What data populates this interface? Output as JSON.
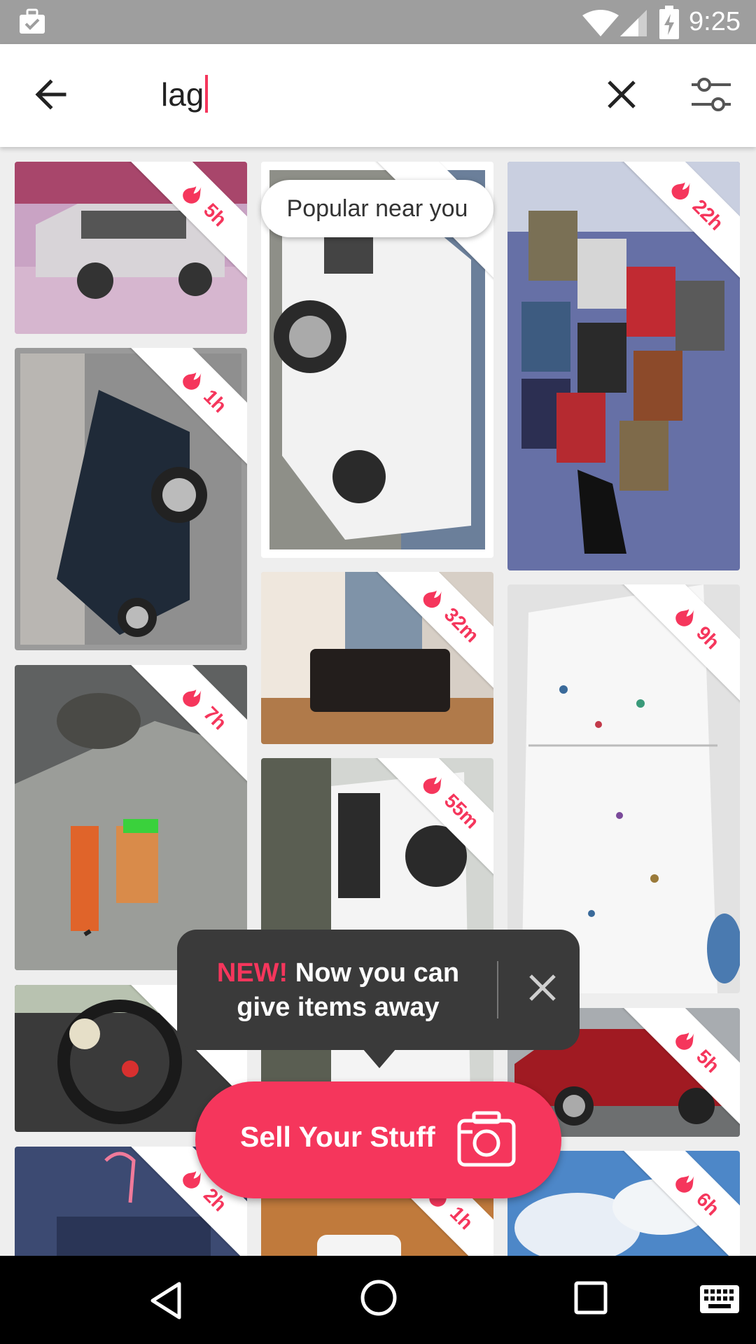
{
  "status_bar": {
    "time": "9:25"
  },
  "search": {
    "query": "lag"
  },
  "tooltip": {
    "popular": "Popular near you"
  },
  "cards": [
    {
      "age": "5h"
    },
    {
      "age": "1h"
    },
    {
      "age": "7h"
    },
    {
      "age": ""
    },
    {
      "age": "2h"
    },
    {
      "age": ""
    },
    {
      "age": "32m"
    },
    {
      "age": "55m"
    },
    {
      "age": "1h"
    },
    {
      "age": "22h"
    },
    {
      "age": "9h"
    },
    {
      "age": "5h"
    },
    {
      "age": "6h"
    }
  ],
  "promo": {
    "new_label": "NEW!",
    "line1": "Now you can",
    "line2": "give items away"
  },
  "sell_button": {
    "label": "Sell Your Stuff"
  },
  "colors": {
    "accent": "#f5365c",
    "promo_bg": "#3a3a3a",
    "status_bar": "#9e9e9e"
  },
  "icons": [
    "briefcase-check-icon",
    "wifi-icon",
    "signal-icon",
    "battery-charging-icon",
    "back-arrow-icon",
    "close-icon",
    "filter-sliders-icon",
    "flame-icon",
    "camera-icon",
    "nav-back-icon",
    "nav-home-icon",
    "nav-recents-icon",
    "keyboard-icon"
  ]
}
